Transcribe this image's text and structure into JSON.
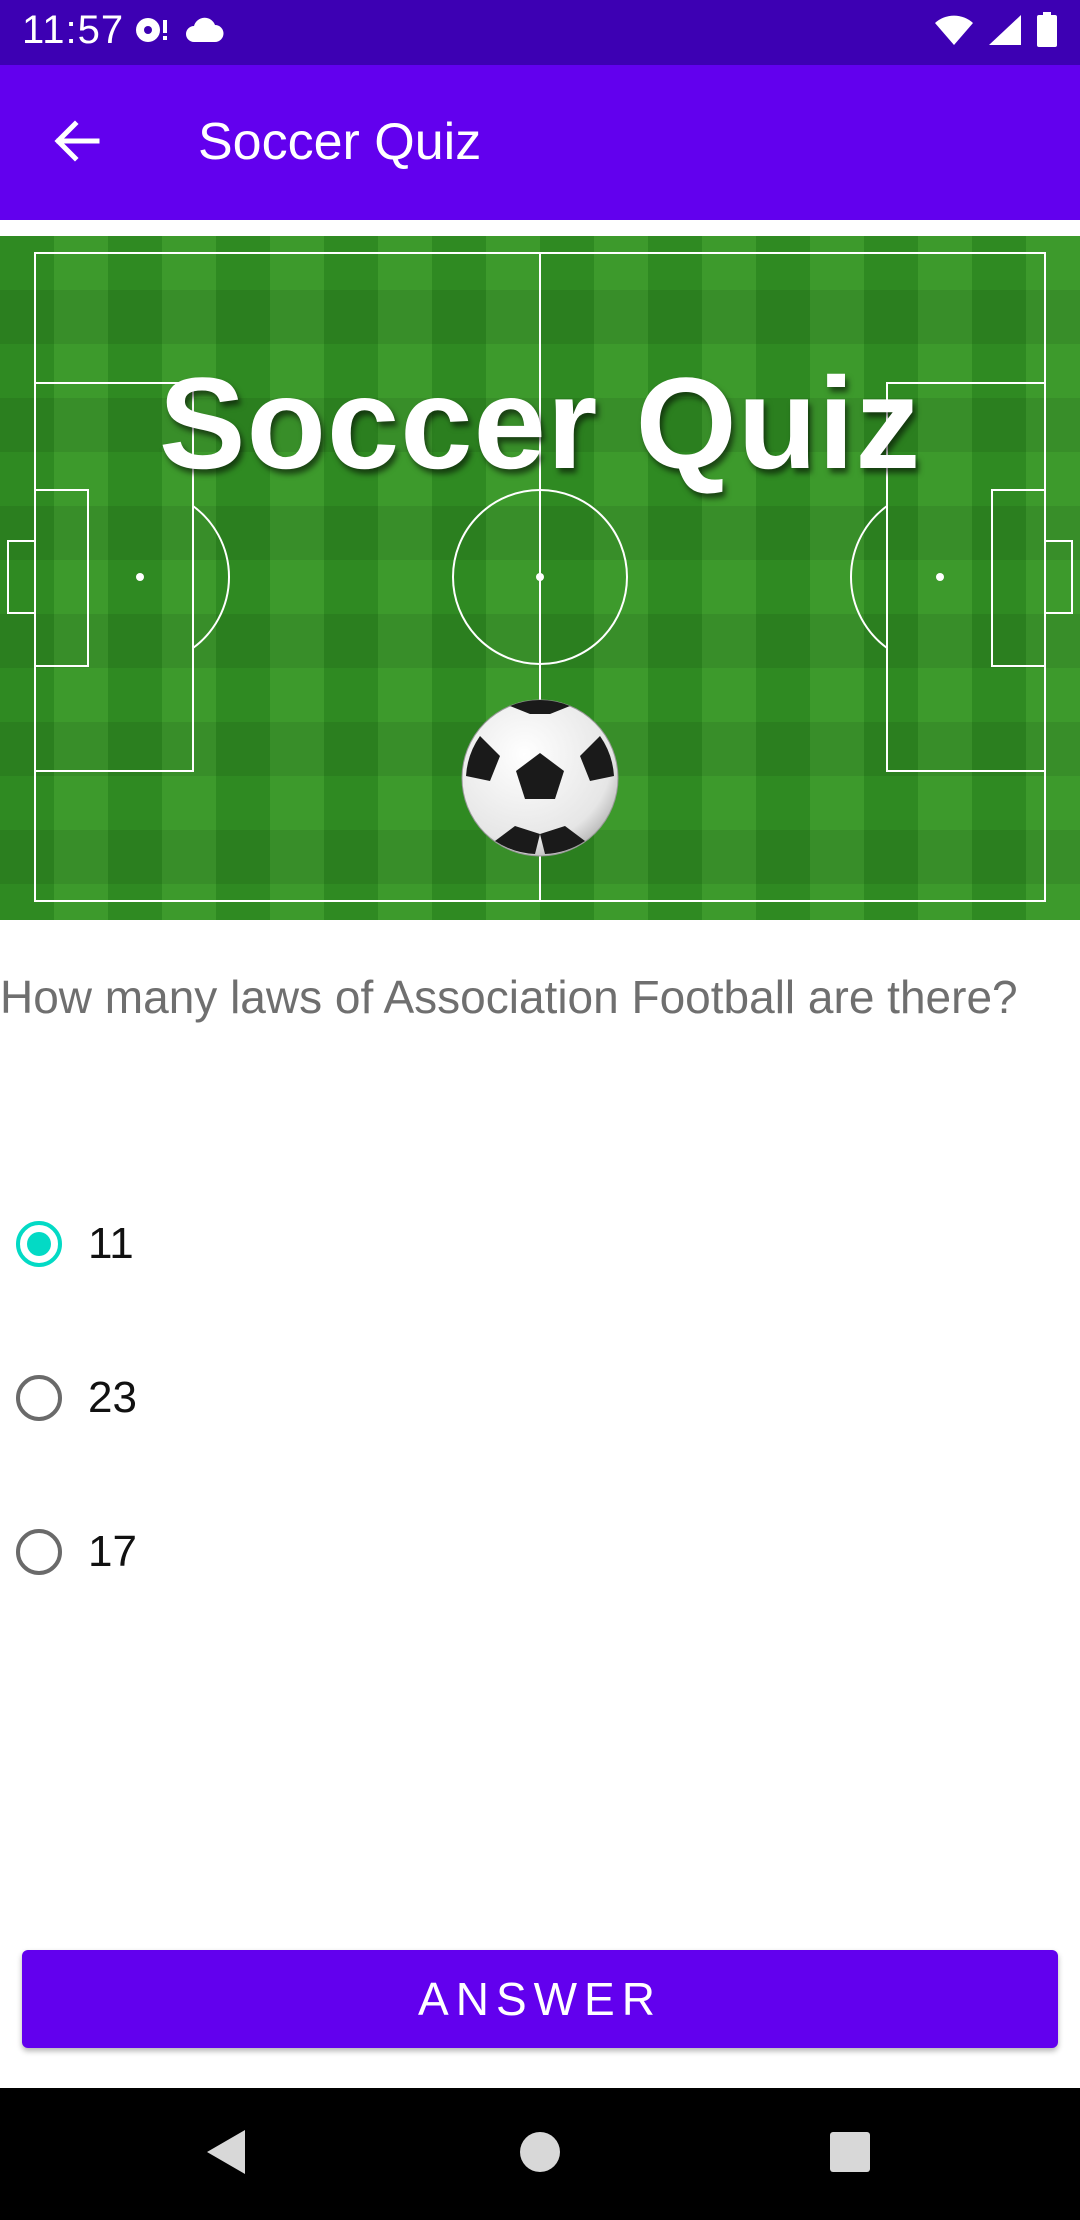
{
  "status_bar": {
    "time": "11:57",
    "left_icons": [
      "media-icon",
      "cloud-icon"
    ],
    "right_icons": [
      "wifi-icon",
      "cell-signal-icon",
      "battery-icon"
    ]
  },
  "app_bar": {
    "back_icon": "arrow-left-icon",
    "title": "Soccer Quiz",
    "color": "#6200ee"
  },
  "banner": {
    "title": "Soccer Quiz",
    "image": "soccer-field-with-ball"
  },
  "question": {
    "text": "How many laws of Association Football are there?"
  },
  "options": [
    {
      "label": "11",
      "selected": true
    },
    {
      "label": "23",
      "selected": false
    },
    {
      "label": "17",
      "selected": false
    }
  ],
  "answer_button": {
    "label": "ANSWER"
  },
  "nav_bar": {
    "buttons": [
      "back-triangle-icon",
      "home-circle-icon",
      "recents-square-icon"
    ]
  },
  "colors": {
    "status_bar": "#3d00b3",
    "primary": "#6200ee",
    "accent": "#03dac5"
  }
}
